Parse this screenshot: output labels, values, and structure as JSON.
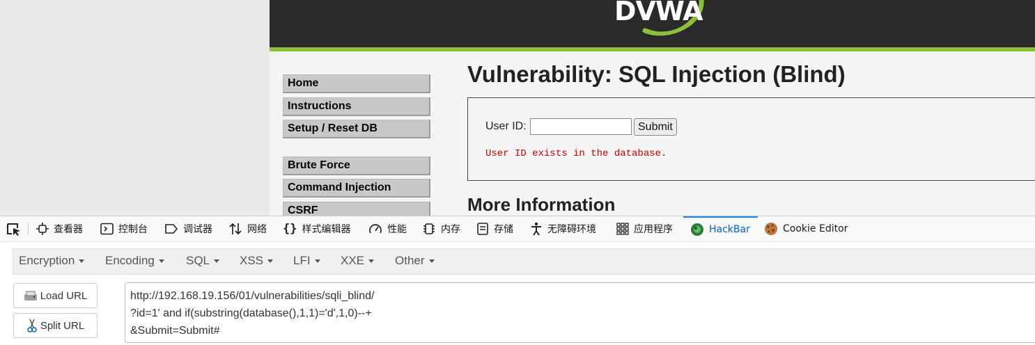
{
  "dvwa": {
    "logo_text": "DVWA",
    "menu": [
      "Home",
      "Instructions",
      "Setup / Reset DB"
    ],
    "menu2": [
      "Brute Force",
      "Command Injection",
      "CSRF"
    ],
    "title": "Vulnerability: SQL Injection (Blind)",
    "form": {
      "label": "User ID:",
      "input_value": "",
      "submit": "Submit"
    },
    "result": "User ID exists in the database.",
    "more_info": "More Information"
  },
  "devtools": {
    "tabs": [
      {
        "label": "查看器",
        "icon": "inspector-icon"
      },
      {
        "label": "控制台",
        "icon": "console-icon"
      },
      {
        "label": "调试器",
        "icon": "debugger-icon"
      },
      {
        "label": "网络",
        "icon": "network-icon"
      },
      {
        "label": "样式编辑器",
        "icon": "style-editor-icon"
      },
      {
        "label": "性能",
        "icon": "performance-icon"
      },
      {
        "label": "内存",
        "icon": "memory-icon"
      },
      {
        "label": "存储",
        "icon": "storage-icon"
      },
      {
        "label": "无障碍环境",
        "icon": "accessibility-icon"
      },
      {
        "label": "应用程序",
        "icon": "application-icon"
      },
      {
        "label": "HackBar",
        "icon": "hackbar-icon",
        "active": true
      },
      {
        "label": "Cookie Editor",
        "icon": "cookie-icon"
      }
    ],
    "active_color": "#0060df"
  },
  "hackbar": {
    "menus": [
      "Encryption",
      "Encoding",
      "SQL",
      "XSS",
      "LFI",
      "XXE",
      "Other"
    ],
    "load_url": "Load URL",
    "split_url": "Split URL",
    "url_lines": [
      "http://192.168.19.156/01/vulnerabilities/sqli_blind/",
      "?id=1' and if(substring(database(),1,1)='d',1,0)--+",
      "&Submit=Submit#"
    ]
  },
  "colors": {
    "header_bg": "#2a2a2a",
    "accent_green": "#8dbf3c",
    "result_red": "#cc0000"
  }
}
